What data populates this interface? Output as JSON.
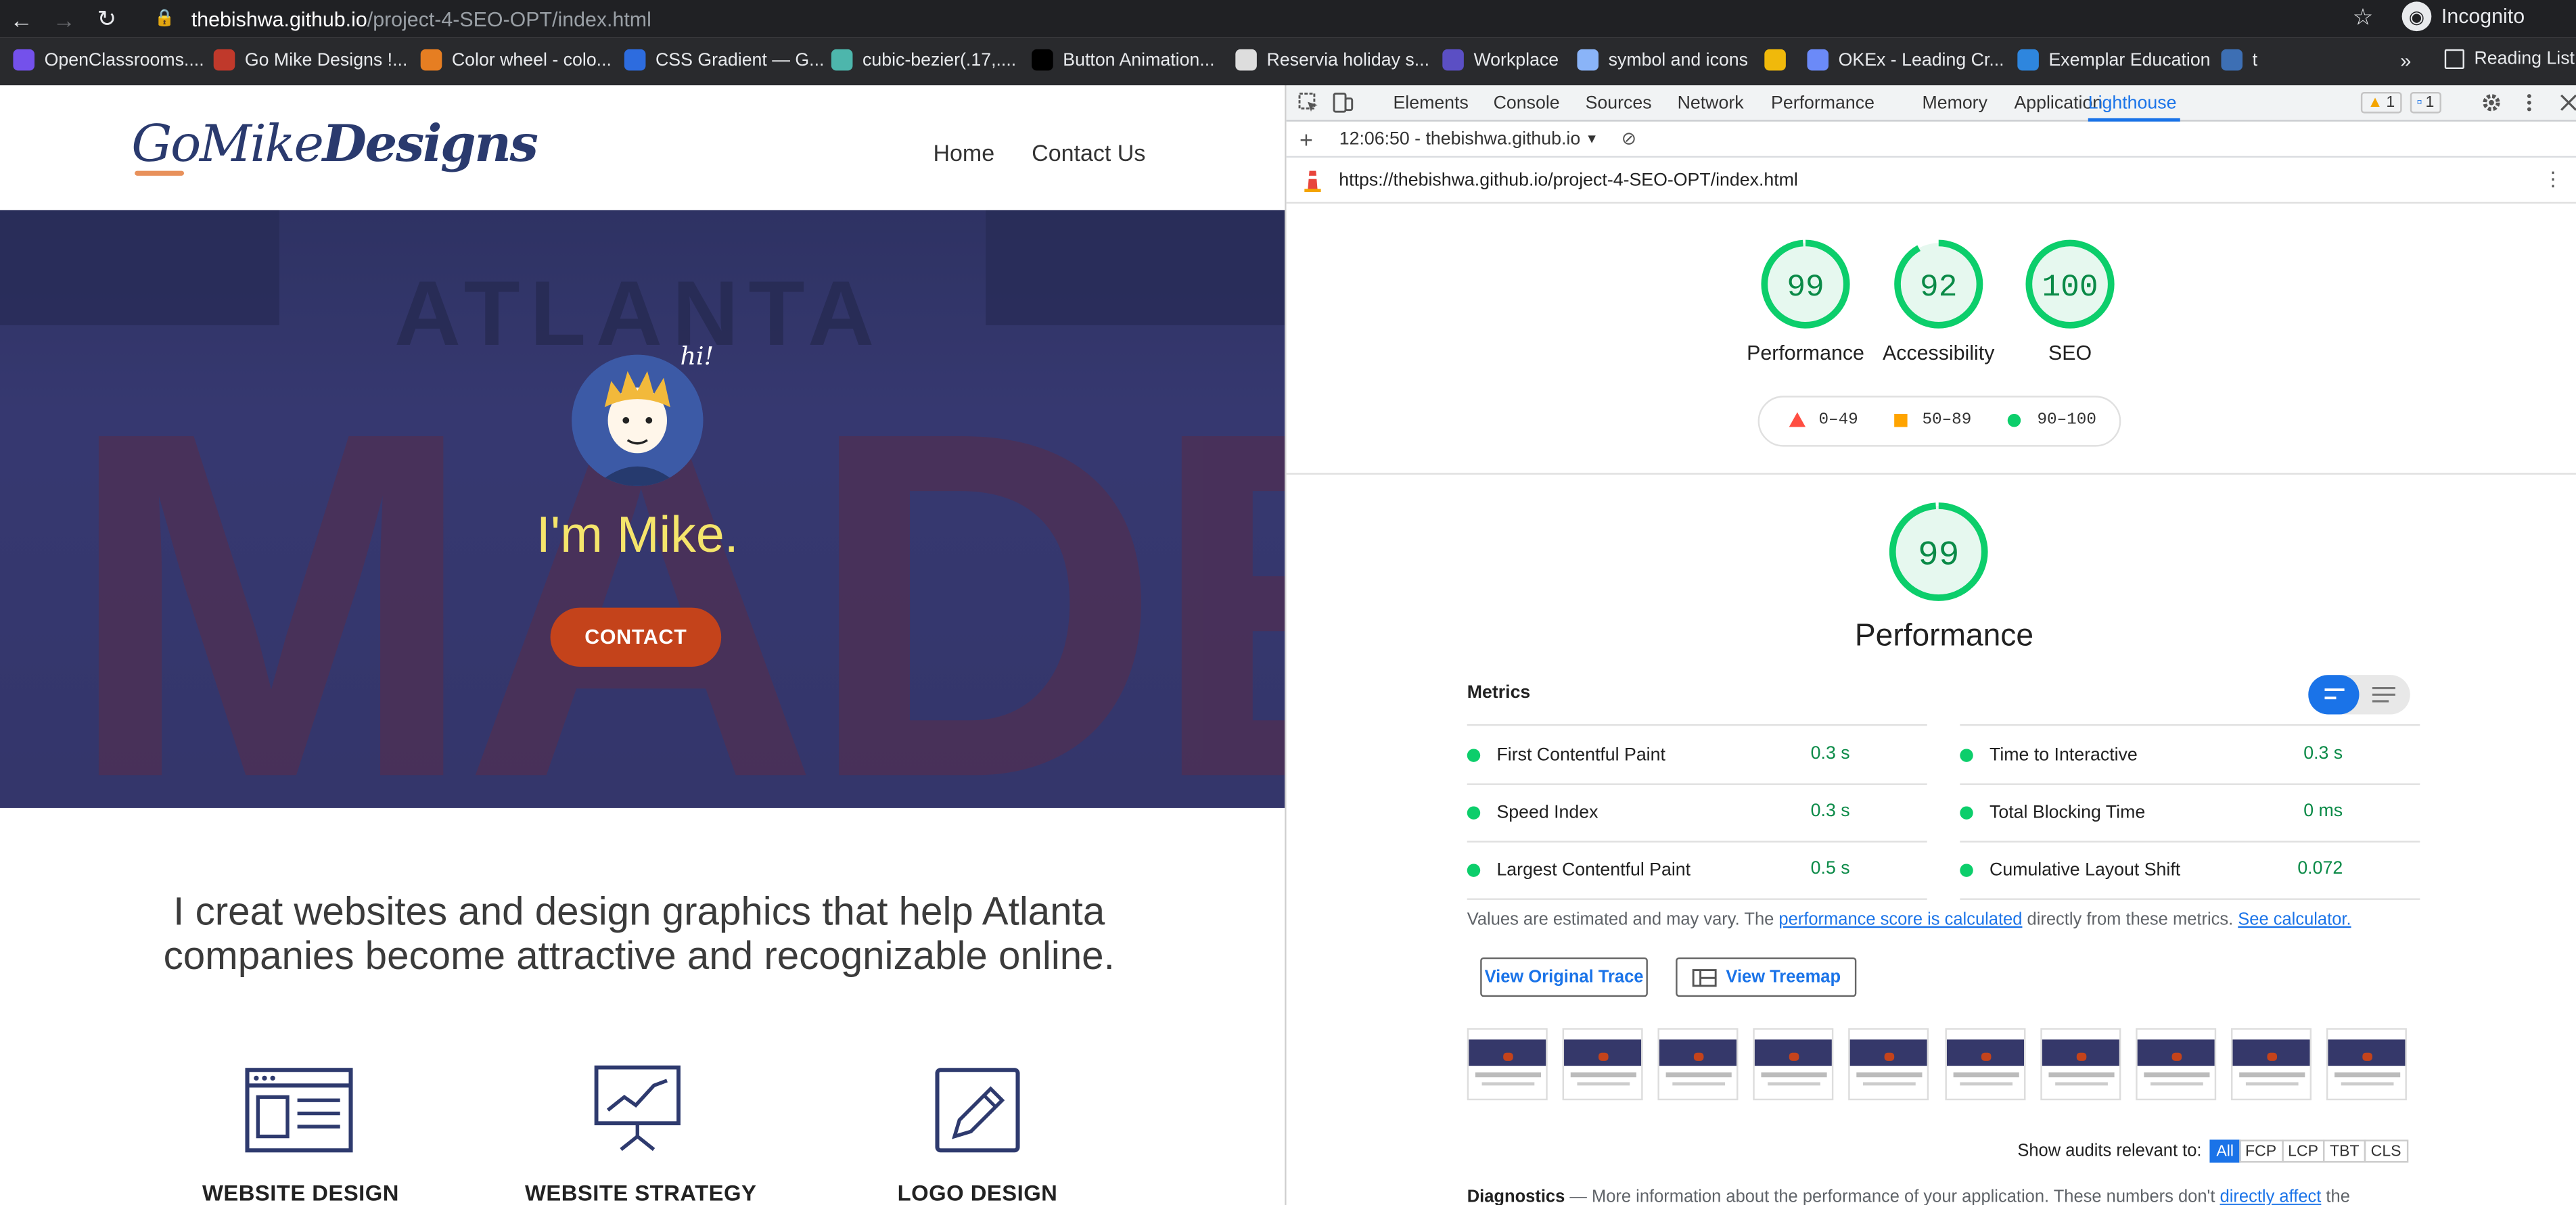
{
  "browser": {
    "url_host": "thebishwa.github.io",
    "url_path": "/project-4-SEO-OPT/index.html",
    "profile_label": "Incognito"
  },
  "bookmarks": [
    {
      "label": "OpenClassrooms....",
      "color": "#7451eb"
    },
    {
      "label": "Go Mike Designs !...",
      "color": "#c0392b"
    },
    {
      "label": "Color wheel - colo...",
      "color": "#e67e22"
    },
    {
      "label": "CSS Gradient — G...",
      "color": "#2d6cdf"
    },
    {
      "label": "cubic-bezier(.17,....",
      "color": "#4db6ac"
    },
    {
      "label": "Button Animation...",
      "color": "#000000"
    },
    {
      "label": "Reservia holiday s...",
      "color": "#dddddd"
    },
    {
      "label": "Workplace",
      "color": "#5b4fc4"
    },
    {
      "label": "symbol and icons",
      "color": "#8ab4f8"
    },
    {
      "label": "",
      "color": "#f0b90b"
    },
    {
      "label": "OKEx - Leading Cr...",
      "color": "#6b8af8"
    },
    {
      "label": "Exemplar Education",
      "color": "#2e86de"
    },
    {
      "label": "t",
      "color": "#3d6fb4"
    }
  ],
  "bookmarks_more": "»",
  "reading_list": "Reading List",
  "site": {
    "logo_go": "Go",
    "logo_mike": "Mike",
    "logo_designs": "Designs",
    "nav": [
      "Home",
      "Contact Us"
    ],
    "hero_sign_top": "ATLANTA",
    "hero_sign_big": "MADE",
    "hi": "hi!",
    "hero_title": "I'm Mike.",
    "cta": "CONTACT",
    "lead": "I creat websites and design graphics that help Atlanta companies become attractive and recognizable online.",
    "services": [
      "WEBSITE DESIGN",
      "WEBSITE STRATEGY",
      "LOGO DESIGN"
    ]
  },
  "devtools": {
    "tabs": [
      "Elements",
      "Console",
      "Sources",
      "Network",
      "Performance",
      "Memory",
      "Application",
      "Lighthouse"
    ],
    "active_tab": "Lighthouse",
    "warn_count": "1",
    "msg_count": "1",
    "report_selector": "12:06:50 - thebishwa.github.i⁠o",
    "report_url": "https://thebishwa.github.io/project-4-SEO-OPT/index.html",
    "scores": [
      {
        "value": 99,
        "label": "Performance"
      },
      {
        "value": 92,
        "label": "Accessibility"
      },
      {
        "value": 100,
        "label": "SEO"
      }
    ],
    "legend": [
      "0–49",
      "50–89",
      "90–100"
    ],
    "perf_score": 99,
    "perf_title": "Performance",
    "metrics_title": "Metrics",
    "metrics_left": [
      {
        "name": "First Contentful Paint",
        "value": "0.3 s"
      },
      {
        "name": "Speed Index",
        "value": "0.3 s"
      },
      {
        "name": "Largest Contentful Paint",
        "value": "0.5 s"
      }
    ],
    "metrics_right": [
      {
        "name": "Time to Interactive",
        "value": "0.3 s"
      },
      {
        "name": "Total Blocking Time",
        "value": "0 ms"
      },
      {
        "name": "Cumulative Layout Shift",
        "value": "0.072"
      }
    ],
    "note_pre": "Values are estimated and may vary. The ",
    "note_link1": "performance score is calculated",
    "note_mid": " directly from these metrics. ",
    "note_link2": "See calculator.",
    "btn_trace": "View Original Trace",
    "btn_treemap": "View Treemap",
    "filter_label": "Show audits relevant to:",
    "filter_chips": [
      "All",
      "FCP",
      "LCP",
      "TBT",
      "CLS"
    ],
    "diag_title": "Diagnostics",
    "diag_dash": " — ",
    "diag_text": "More information about the performance of your application. These numbers don't ",
    "diag_link": "directly affect",
    "diag_end": " the"
  },
  "colors": {
    "pass": "#0cce6b",
    "average": "#ffa400",
    "fail": "#ff4e42",
    "accent": "#1a73e8",
    "cta": "#c4431b"
  }
}
